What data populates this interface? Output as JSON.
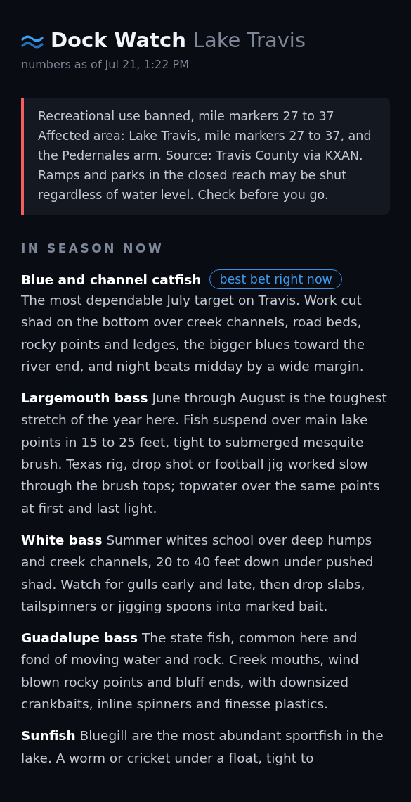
{
  "header": {
    "app_name": "Dock Watch",
    "lake": "Lake Travis",
    "updated": "numbers as of Jul 21, 1:22 PM"
  },
  "alert": {
    "title": "Recreational use banned, mile markers 27 to 37",
    "text": "Affected area: Lake Travis, mile markers 27 to 37, and the Pedernales arm. Source: Travis County via KXAN. Ramps and parks in the closed reach may be shut regardless of water level. Check before you go."
  },
  "section": {
    "heading": "IN SEASON NOW",
    "species": [
      {
        "kind": "featured",
        "name": "Blue and channel catfish",
        "badge": "best bet right now",
        "text": "The most dependable July target on Travis. Work cut shad on the bottom over creek channels, road beds, rocky points and ledges, the bigger blues toward the river end, and night beats midday by a wide margin."
      },
      {
        "kind": "plain",
        "name": "Largemouth bass",
        "text": "June through August is the toughest stretch of the year here. Fish suspend over main lake points in 15 to 25 feet, tight to submerged mesquite brush. Texas rig, drop shot or football jig worked slow through the brush tops; topwater over the same points at first and last light."
      },
      {
        "kind": "plain",
        "name": "White bass",
        "text": "Summer whites school over deep humps and creek channels, 20 to 40 feet down under pushed shad. Watch for gulls early and late, then drop slabs, tailspinners or jigging spoons into marked bait."
      },
      {
        "kind": "plain",
        "name": "Guadalupe bass",
        "text": "The state fish, common here and fond of moving water and rock. Creek mouths, wind blown rocky points and bluff ends, with downsized crankbaits, inline spinners and finesse plastics."
      },
      {
        "kind": "plain",
        "name": "Sunfish",
        "text": "Bluegill are the most abundant sportfish in the lake. A worm or cricket under a float, tight to"
      }
    ]
  }
}
